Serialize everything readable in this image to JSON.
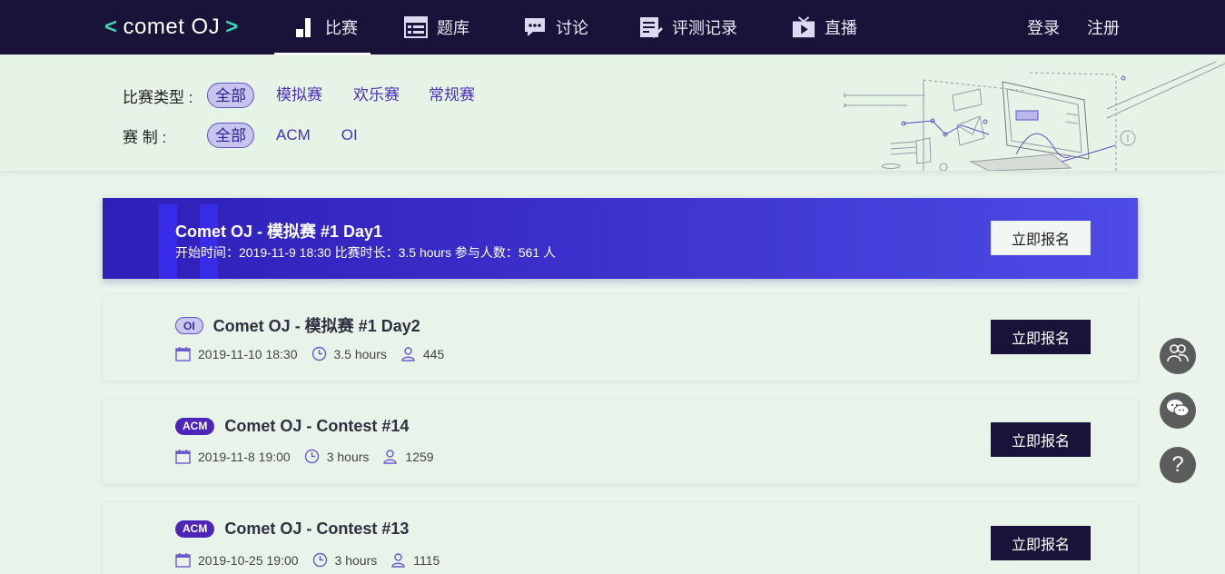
{
  "brand": {
    "left": "<",
    "name": "comet OJ",
    "right": ">"
  },
  "nav": [
    {
      "label": "比赛",
      "icon": "contest-bars-icon",
      "active": true
    },
    {
      "label": "题库",
      "icon": "problem-list-icon",
      "active": false
    },
    {
      "label": "讨论",
      "icon": "chat-bubble-icon",
      "active": false
    },
    {
      "label": "评测记录",
      "icon": "edit-record-icon",
      "active": false
    },
    {
      "label": "直播",
      "icon": "tv-play-icon",
      "active": false
    }
  ],
  "auth": {
    "login": "登录",
    "register": "注册"
  },
  "filters": {
    "type_label": "比赛类型 :",
    "type_options": [
      "全部",
      "模拟赛",
      "欢乐赛",
      "常规赛"
    ],
    "format_label": "赛 制 :",
    "format_options": [
      "全部",
      "ACM",
      "OI"
    ]
  },
  "featured": {
    "title": "Comet OJ - 模拟赛 #1 Day1",
    "meta": "开始时间：2019-11-9 18:30 比赛时长：3.5 hours 参与人数：561 人",
    "button": "立即报名"
  },
  "contests": [
    {
      "badge": "OI",
      "title": "Comet OJ - 模拟赛 #1 Day2",
      "date": "2019-11-10 18:30",
      "duration": "3.5 hours",
      "participants": "445",
      "button": "立即报名"
    },
    {
      "badge": "ACM",
      "title": "Comet OJ - Contest #14",
      "date": "2019-11-8 19:00",
      "duration": "3 hours",
      "participants": "1259",
      "button": "立即报名"
    },
    {
      "badge": "ACM",
      "title": "Comet OJ - Contest #13",
      "date": "2019-10-25 19:00",
      "duration": "3 hours",
      "participants": "1115",
      "button": "立即报名"
    }
  ],
  "fabs": [
    {
      "icon": "users-icon"
    },
    {
      "icon": "wechat-icon"
    },
    {
      "icon": "help-icon",
      "label": "?"
    }
  ],
  "colors": {
    "nav_bg": "#19133a",
    "accent": "#4a2fb8",
    "brand_bracket": "#3dd2b0",
    "page_bg": "#e9f4ea"
  }
}
